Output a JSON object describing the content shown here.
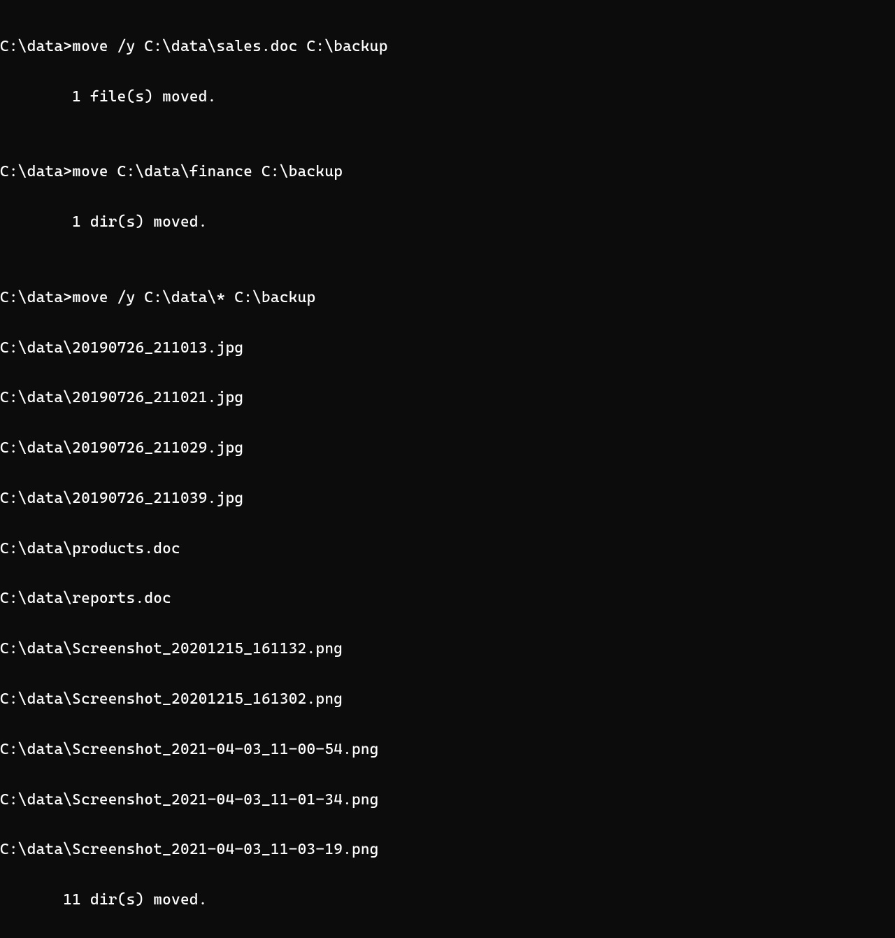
{
  "lines": [
    "C:\\data>move /y C:\\data\\sales.doc C:\\backup",
    "        1 file(s) moved.",
    "",
    "C:\\data>move C:\\data\\finance C:\\backup",
    "        1 dir(s) moved.",
    "",
    "C:\\data>move /y C:\\data\\* C:\\backup",
    "C:\\data\\20190726_211013.jpg",
    "C:\\data\\20190726_211021.jpg",
    "C:\\data\\20190726_211029.jpg",
    "C:\\data\\20190726_211039.jpg",
    "C:\\data\\products.doc",
    "C:\\data\\reports.doc",
    "C:\\data\\Screenshot_20201215_161132.png",
    "C:\\data\\Screenshot_20201215_161302.png",
    "C:\\data\\Screenshot_2021-04-03_11-00-54.png",
    "C:\\data\\Screenshot_2021-04-03_11-01-34.png",
    "C:\\data\\Screenshot_2021-04-03_11-03-19.png",
    "       11 dir(s) moved."
  ]
}
